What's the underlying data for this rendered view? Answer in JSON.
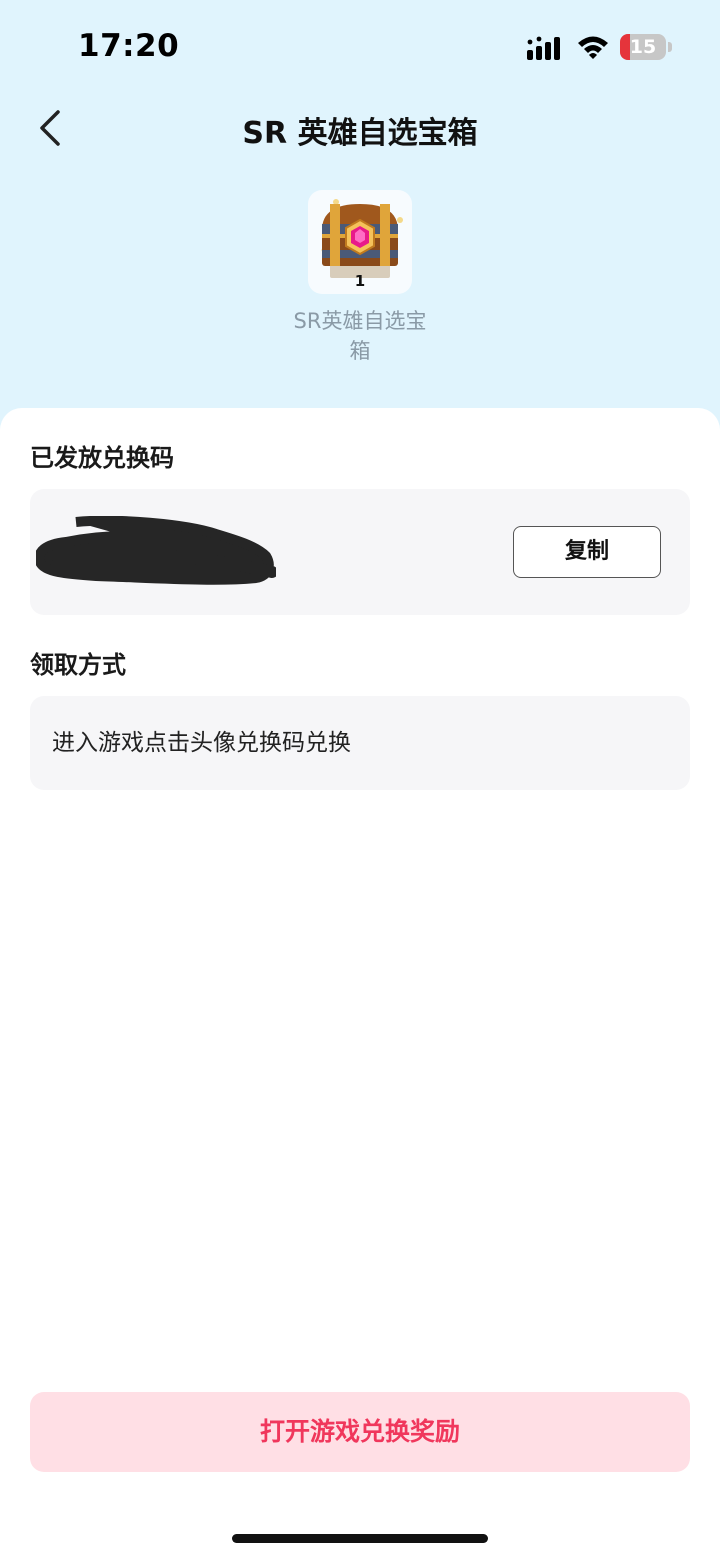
{
  "status_bar": {
    "time": "17:20",
    "battery": "15"
  },
  "header": {
    "title": "SR 英雄自选宝箱",
    "back_icon": "chevron-left-icon"
  },
  "item": {
    "icon": "treasure-chest-icon",
    "count": "1",
    "name": "SR英雄自选宝箱"
  },
  "code_section": {
    "label": "已发放兑换码",
    "copy_label": "复制"
  },
  "method_section": {
    "label": "领取方式",
    "text": "进入游戏点击头像兑换码兑换"
  },
  "action": {
    "open_label": "打开游戏兑换奖励"
  },
  "colors": {
    "header_bg": "#e0f4fd",
    "accent": "#f0375c",
    "button_bg": "#ffdfe5",
    "battery_low": "#e5343b"
  }
}
